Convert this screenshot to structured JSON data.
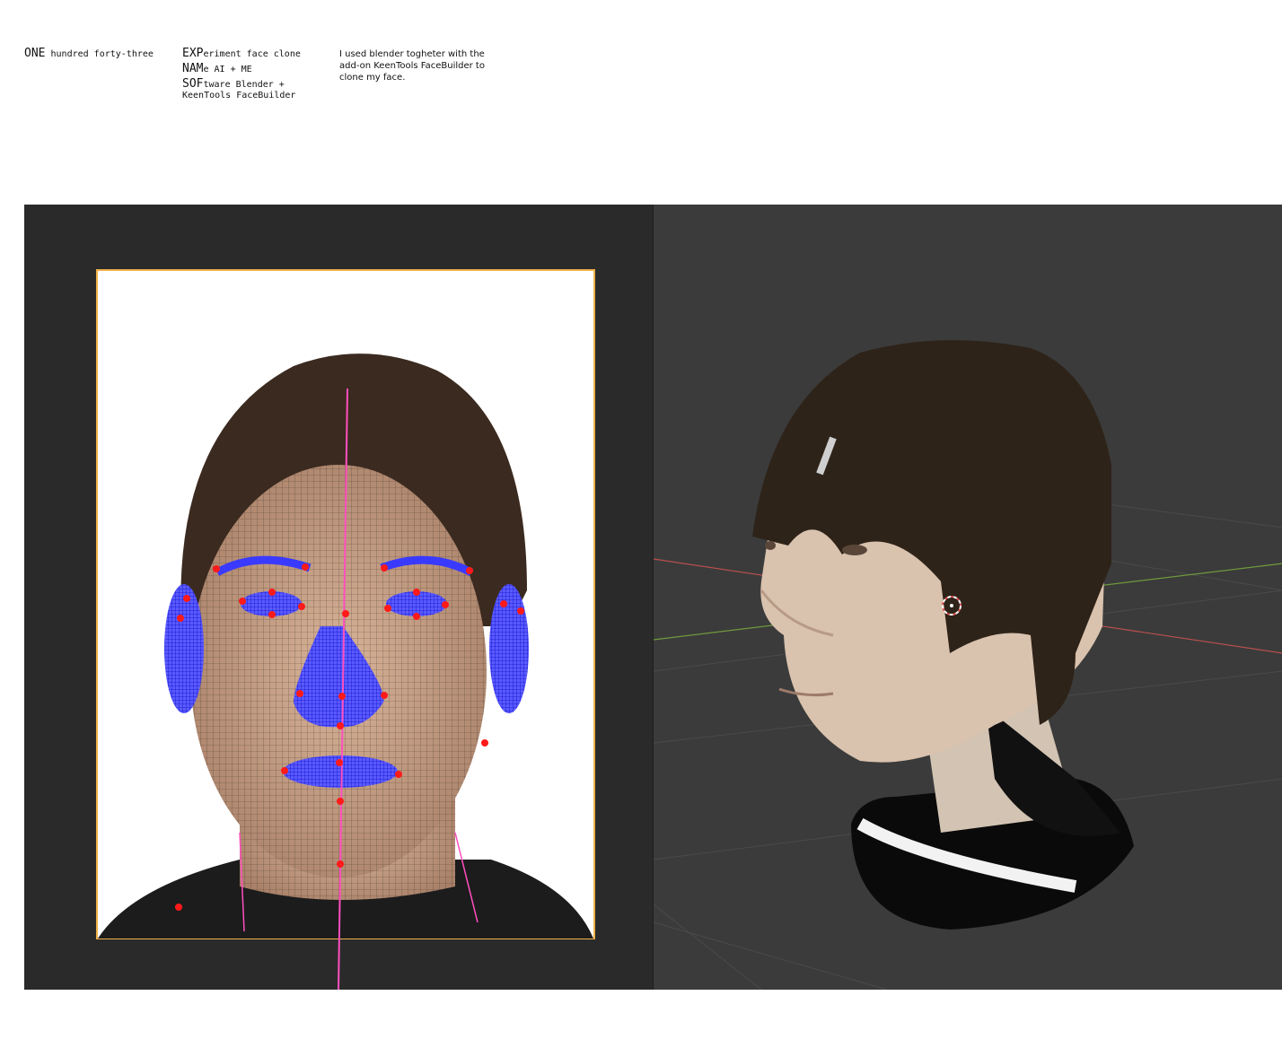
{
  "header": {
    "title": {
      "prefix": "ONE",
      "rest": "hundred forty-three"
    },
    "meta": [
      {
        "prefix": "EXP",
        "rest": "eriment face clone"
      },
      {
        "prefix": "NAM",
        "rest": "e AI + ME"
      },
      {
        "prefix": "SOF",
        "rest": "tware Blender +"
      },
      {
        "prefix": "",
        "rest": "KeenTools FaceBuilder"
      }
    ],
    "description": "I used blender togheter with the add-on KeenTools FaceBuilder to clone my face."
  },
  "panels": {
    "left": {
      "label": "facebuilder-pin-mode",
      "frame_color": "#f0b24a",
      "pin_color": "#ff1a1a",
      "mesh_color": "#2b2bff"
    },
    "right": {
      "label": "blender-3d-viewport",
      "x_axis_color": "#b8504e",
      "y_axis_color": "#6f9a3c"
    }
  }
}
